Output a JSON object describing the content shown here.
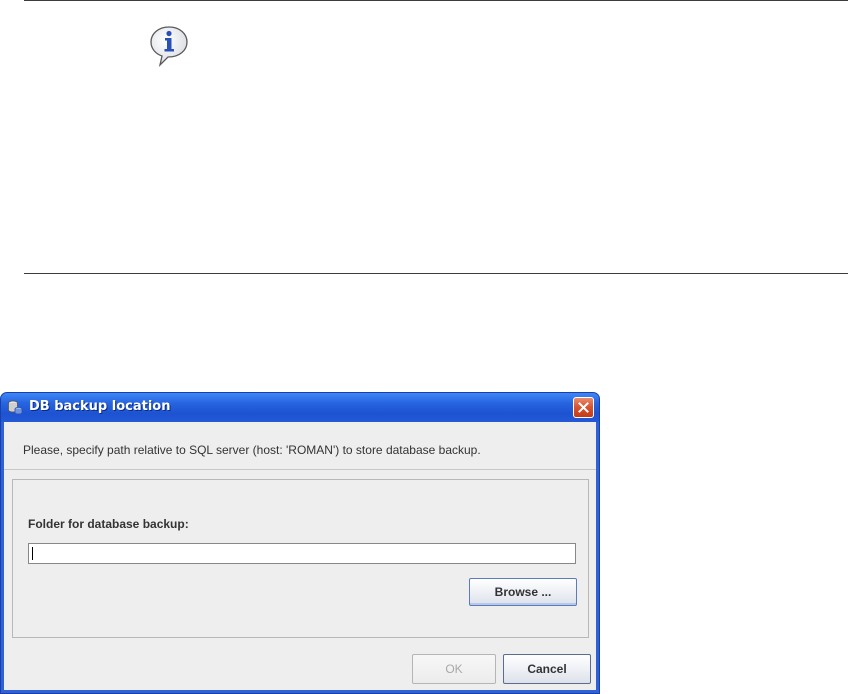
{
  "dialog": {
    "title": "DB backup location",
    "prompt": "Please, specify path relative to SQL server (host: 'ROMAN') to store database backup.",
    "folder_label": "Folder for database backup:",
    "folder_value": "",
    "browse_label": "Browse ...",
    "ok_label": "OK",
    "cancel_label": "Cancel"
  },
  "icons": {
    "top": "info-balloon-icon",
    "title": "database-icon",
    "close": "close-icon"
  },
  "colors": {
    "titlebar": "#2764e0",
    "close_button": "#d7532f",
    "info_icon": "#2a4fb8"
  }
}
